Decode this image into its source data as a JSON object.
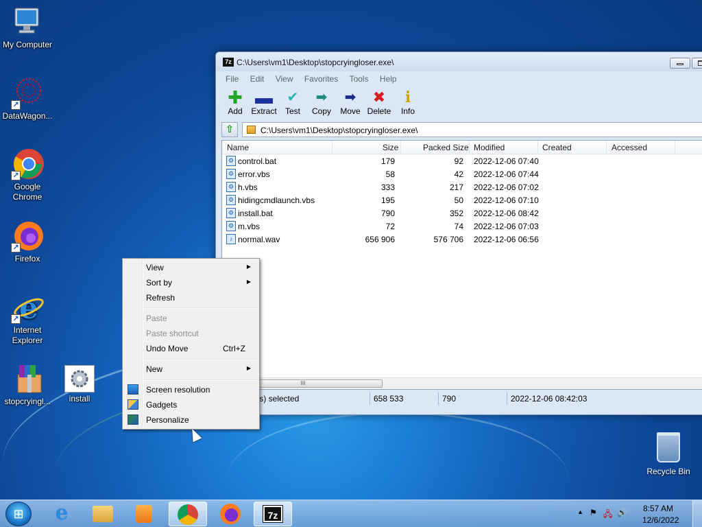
{
  "desktop": {
    "icons": [
      {
        "label": "My Computer",
        "icon": "computer-icon"
      },
      {
        "label": "DataWagon...",
        "icon": "datawagon-icon"
      },
      {
        "label": "Google Chrome",
        "icon": "chrome-icon"
      },
      {
        "label": "Firefox",
        "icon": "firefox-icon"
      },
      {
        "label": "Internet Explorer",
        "icon": "ie-icon"
      },
      {
        "label": "stopcryingl...",
        "icon": "winrar-archive-icon"
      },
      {
        "label": "install",
        "icon": "settings-script-icon"
      }
    ],
    "recycle_bin": "Recycle Bin"
  },
  "window": {
    "app_icon": "7z",
    "title": "C:\\Users\\vm1\\Desktop\\stopcryingloser.exe\\",
    "menu": [
      "File",
      "Edit",
      "View",
      "Favorites",
      "Tools",
      "Help"
    ],
    "toolbar": [
      {
        "label": "Add",
        "icon": "add-icon",
        "color": "#22a822"
      },
      {
        "label": "Extract",
        "icon": "extract-icon",
        "color": "#1a2fa0"
      },
      {
        "label": "Test",
        "icon": "test-icon",
        "color": "#23b5b0"
      },
      {
        "label": "Copy",
        "icon": "copy-icon",
        "color": "#1e8a7a"
      },
      {
        "label": "Move",
        "icon": "move-icon",
        "color": "#1a2a8a"
      },
      {
        "label": "Delete",
        "icon": "delete-icon",
        "color": "#d81e1e"
      },
      {
        "label": "Info",
        "icon": "info-icon",
        "color": "#c8a800"
      }
    ],
    "address": "C:\\Users\\vm1\\Desktop\\stopcryingloser.exe\\",
    "columns": [
      "Name",
      "Size",
      "Packed Size",
      "Modified",
      "Created",
      "Accessed"
    ],
    "files": [
      {
        "name": "control.bat",
        "size": "179",
        "packed": "92",
        "modified": "2022-12-06 07:40"
      },
      {
        "name": "error.vbs",
        "size": "58",
        "packed": "42",
        "modified": "2022-12-06 07:44"
      },
      {
        "name": "h.vbs",
        "size": "333",
        "packed": "217",
        "modified": "2022-12-06 07:02"
      },
      {
        "name": "hidingcmdlaunch.vbs",
        "size": "195",
        "packed": "50",
        "modified": "2022-12-06 07:10"
      },
      {
        "name": "install.bat",
        "size": "790",
        "packed": "352",
        "modified": "2022-12-06 08:42"
      },
      {
        "name": "m.vbs",
        "size": "72",
        "packed": "74",
        "modified": "2022-12-06 07:03"
      },
      {
        "name": "normal.wav",
        "size": "656 906",
        "packed": "576 706",
        "modified": "2022-12-06 06:56"
      }
    ],
    "scroll_grip": "III",
    "status": {
      "selected": "t(s) selected",
      "size": "658 533",
      "packed": "790",
      "modified": "2022-12-06 08:42:03"
    }
  },
  "context_menu": {
    "view": "View",
    "sort_by": "Sort by",
    "refresh": "Refresh",
    "paste": "Paste",
    "paste_shortcut": "Paste shortcut",
    "undo_move": "Undo Move",
    "undo_shortcut": "Ctrl+Z",
    "new": "New",
    "screen_resolution": "Screen resolution",
    "gadgets": "Gadgets",
    "personalize": "Personalize"
  },
  "taskbar": {
    "pinned": [
      "Internet Explorer",
      "Windows Explorer",
      "Media Player",
      "Google Chrome",
      "Firefox",
      "7-Zip"
    ],
    "clock_time": "8:57 AM",
    "clock_date": "12/6/2022"
  }
}
